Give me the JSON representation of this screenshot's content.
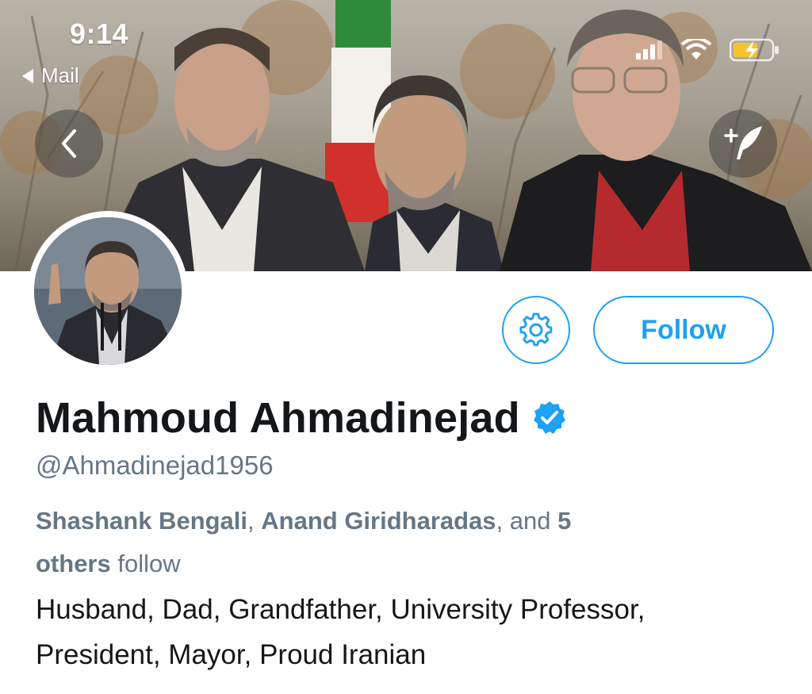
{
  "status_bar": {
    "time": "9:14",
    "back_app": "Mail"
  },
  "header": {
    "back_icon": "chevron-left-icon",
    "compose_icon": "add-feather-icon"
  },
  "actions": {
    "settings_icon": "gear-icon",
    "follow_label": "Follow"
  },
  "profile": {
    "name": "Mahmoud Ahmadinejad",
    "verified_icon": "verified-badge-icon",
    "handle": "@Ahmadinejad1956",
    "followers_known": {
      "person_1": "Shashank Bengali",
      "separator": ", ",
      "person_2": "Anand Giridharadas",
      "and_text": ", and ",
      "others_count": "5",
      "others_word": "others",
      "follow_text": " follow"
    },
    "bio_line_1": "Husband, Dad, Grandfather, University Professor,",
    "bio_line_2": "President, Mayor, Proud Iranian"
  },
  "colors": {
    "accent": "#1da1f2",
    "name": "#14171a",
    "secondary": "#657786",
    "verified": "#1da1f2"
  }
}
